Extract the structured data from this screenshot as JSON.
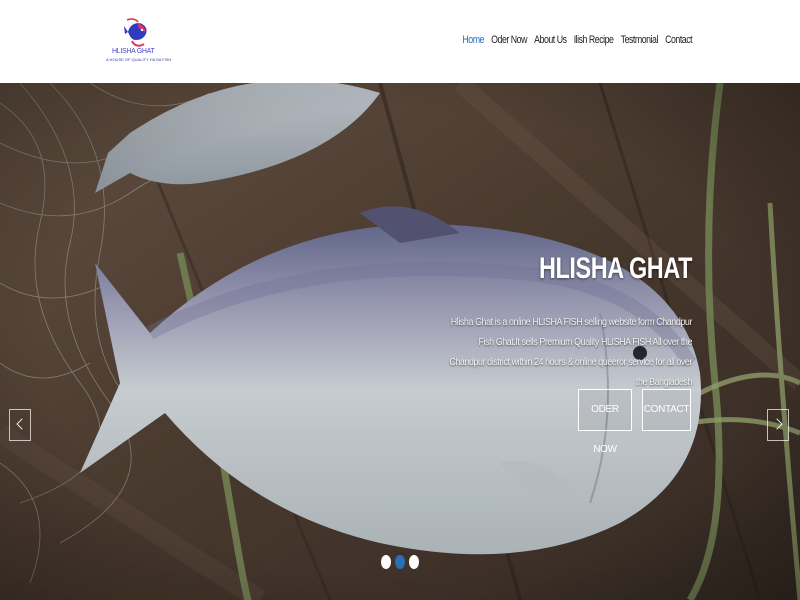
{
  "brand": {
    "name": "HLISHA GHAT",
    "tagline": "A HOUSE OF QUALITY HILSA FISH"
  },
  "nav": {
    "items": [
      {
        "label": "Home",
        "active": true
      },
      {
        "label": "Oder Now",
        "active": false
      },
      {
        "label": "About Us",
        "active": false
      },
      {
        "label": "Ilish Recipe",
        "active": false
      },
      {
        "label": "Testmonial",
        "active": false
      },
      {
        "label": "Contact",
        "active": false
      }
    ]
  },
  "hero": {
    "title": "HLISHA GHAT",
    "description": "Hlisha Ghat is a online HLISHA FISH selling website form Chandpur Fish Ghat.It sells Premium Quality HLISHA FISH All over the Chandpur district within 24 hours & online queeror service for all over the Bangladesh",
    "buttons": {
      "order": "ODER NOW",
      "contact": "CONTACT"
    },
    "slides": {
      "count": 3,
      "active_index": 1
    }
  },
  "colors": {
    "nav_active": "#1d6fc0",
    "nav_text": "#222222",
    "dot_active": "#2b6fb6",
    "logo_accent": "#4a46c8"
  },
  "icons": {
    "logo": "fish-logo-icon",
    "prev": "chevron-left-icon",
    "next": "chevron-right-icon"
  }
}
